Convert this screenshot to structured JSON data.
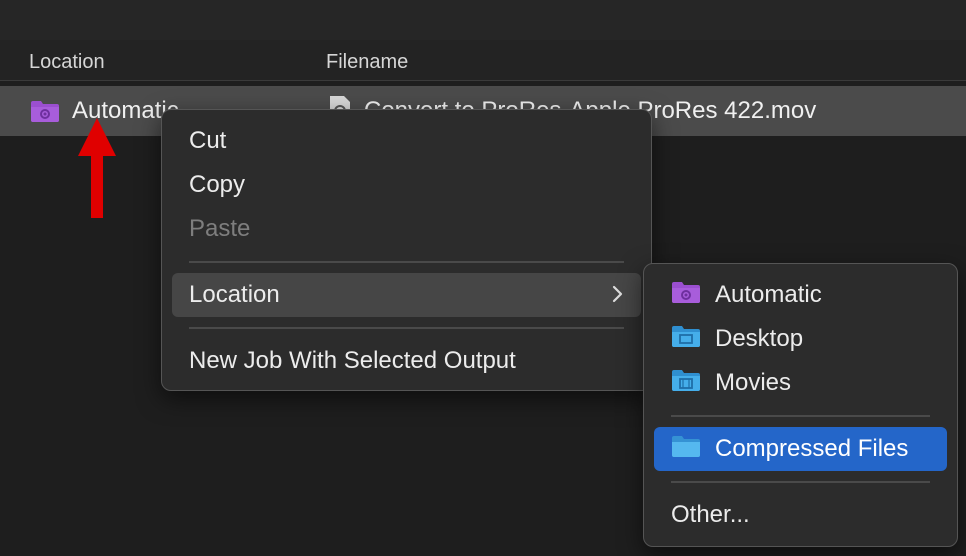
{
  "table": {
    "columns": [
      "Location",
      "Filename"
    ],
    "row": {
      "location": "Automatic",
      "filename": "Convert to ProRes-Apple ProRes 422.mov"
    }
  },
  "context_menu": {
    "items": [
      {
        "label": "Cut",
        "enabled": true
      },
      {
        "label": "Copy",
        "enabled": true
      },
      {
        "label": "Paste",
        "enabled": false
      },
      {
        "label": "Location",
        "submenu": true
      },
      {
        "label": "New Job With Selected Output",
        "enabled": true
      }
    ]
  },
  "location_submenu": {
    "items": [
      {
        "label": "Automatic",
        "icon": "purple-gear-folder-icon"
      },
      {
        "label": "Desktop",
        "icon": "desktop-folder-icon"
      },
      {
        "label": "Movies",
        "icon": "movies-folder-icon"
      },
      {
        "label": "Compressed Files",
        "icon": "blue-folder-icon",
        "selected": true
      },
      {
        "label": "Other..."
      }
    ]
  },
  "colors": {
    "selection": "#2466c9",
    "annotation_arrow": "#e00000",
    "purple_folder": "#9b4fd0",
    "blue_folder": "#3aa3e3"
  }
}
